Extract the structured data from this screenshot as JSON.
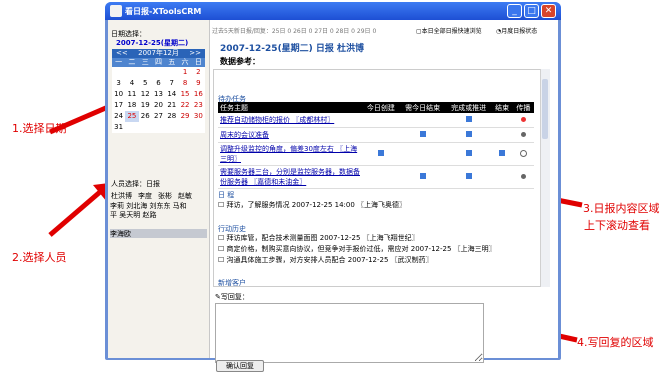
{
  "window": {
    "title": "看日报-XToolsCRM"
  },
  "left": {
    "date_label": "日期选择：",
    "selected_date": "2007-12-25(星期二)",
    "cal": {
      "prev": "<<",
      "month": "2007年12月",
      "next": ">>",
      "dow": [
        "一",
        "二",
        "三",
        "四",
        "五",
        "六",
        "日"
      ],
      "days": [
        "",
        "",
        "",
        "",
        "",
        "1",
        "2",
        "3",
        "4",
        "5",
        "6",
        "7",
        "8",
        "9",
        "10",
        "11",
        "12",
        "13",
        "14",
        "15",
        "16",
        "17",
        "18",
        "19",
        "20",
        "21",
        "22",
        "23",
        "24",
        "25",
        "26",
        "27",
        "28",
        "29",
        "30",
        "31"
      ]
    },
    "person_label": "人员选择：日报",
    "tabs": [
      "杜洪博",
      "李度",
      "张彬",
      "赵敏"
    ],
    "names_line1": "李莉  刘北海  刘东东  马和",
    "names_line2": "平  吴天明  赵路",
    "selected_user": "李海欧"
  },
  "top": {
    "stats": "过去5天新日报/回复：25日 0  26日 0  27日 0  28日 0  29日 0",
    "link1": "本日全部日报快速浏览",
    "link2": "月度日报状态"
  },
  "content": {
    "heading": "2007-12-25(星期二) 日报   杜洪博",
    "subheading": "数据参考：",
    "tasks_section": "待办任务",
    "columns": [
      "任务主题",
      "今日创建",
      "需今日结束",
      "完成或推进",
      "结束",
      "传播"
    ],
    "tasks": [
      {
        "name": "推荐自动储物柜的报价 〖成都林村〗"
      },
      {
        "name": "周末的会议准备"
      },
      {
        "name": "调整升级监控的角度，偏差30度左右 〖上海三明〗"
      },
      {
        "name": "需要服务器三台，分别是监控服务器，数据备份服务器 〖嘉德和未油金〗"
      }
    ],
    "schedule_section": "日 程",
    "schedule": [
      "拜访，了解服务情况 2007-12-25 14:00 〖上海飞奥德〗"
    ],
    "history_section": "行动历史",
    "history": [
      "拜访库管，配合技术测量面图 2007-12-25 〖上海飞翔世纪〗",
      "商定价格，制购买意向协议，但竞争对手报价过低，需应对 2007-12-25 〖上海三明〗",
      "沟通具体施工步骤，对方安排人员配合 2007-12-25 〖武汉制药〗"
    ],
    "new_customer": "新增客户"
  },
  "reply": {
    "label": "写回复：",
    "button": "确认回复"
  },
  "annotations": [
    "1.选择日期",
    "2.选择人员",
    "3.日报内容区域",
    "上下滚动查看",
    "4.写回复的区域"
  ],
  "colors": {
    "accent_red": "#e00000",
    "title_blue": "#1d4fd4"
  }
}
